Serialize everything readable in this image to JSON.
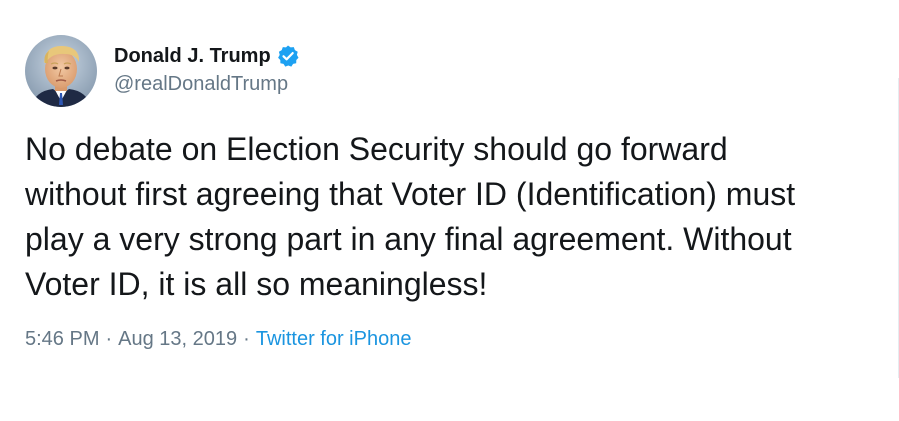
{
  "tweet": {
    "author": {
      "display_name": "Donald J. Trump",
      "handle": "@realDonaldTrump",
      "verified": true,
      "avatar_icon": "profile-photo"
    },
    "text": "No debate on Election Security should go forward\nwithout first agreeing that Voter ID (Identification) must\nplay a very strong part in any final agreement. Without\nVoter ID, it is all so meaningless!",
    "time": "5:46 PM",
    "separator_1": "·",
    "date": "Aug 13, 2019",
    "separator_2": "·",
    "source": "Twitter for iPhone"
  },
  "colors": {
    "text_primary": "#14171a",
    "text_secondary": "#657786",
    "link": "#1b95e0",
    "verified_badge": "#1da1f2"
  }
}
